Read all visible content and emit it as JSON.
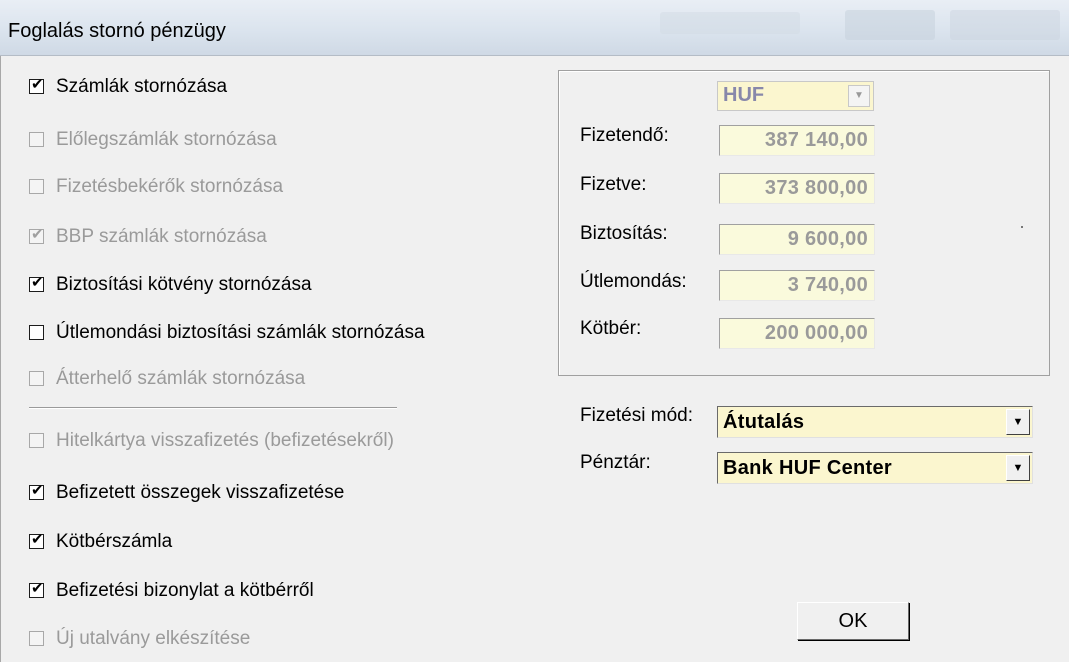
{
  "window": {
    "title": "Foglalás stornó pénzügy"
  },
  "checkboxes": [
    {
      "label": "Számlák stornózása",
      "checked": true,
      "enabled": true
    },
    {
      "label": "Előlegszámlák stornózása",
      "checked": false,
      "enabled": false
    },
    {
      "label": "Fizetésbekérők stornózása",
      "checked": false,
      "enabled": false
    },
    {
      "label": "BBP számlák stornózása",
      "checked": true,
      "enabled": false
    },
    {
      "label": "Biztosítási kötvény stornózása",
      "checked": true,
      "enabled": true
    },
    {
      "label": "Útlemondási biztosítási számlák stornózása",
      "checked": false,
      "enabled": true
    },
    {
      "label": "Átterhelő számlák stornózása",
      "checked": false,
      "enabled": false
    },
    {
      "label": "Hitelkártya visszafizetés (befizetésekről)",
      "checked": false,
      "enabled": false
    },
    {
      "label": "Befizetett összegek visszafizetése",
      "checked": true,
      "enabled": true
    },
    {
      "label": "Kötbérszámla",
      "checked": true,
      "enabled": true
    },
    {
      "label": "Befizetési bizonylat a kötbérről",
      "checked": true,
      "enabled": true
    },
    {
      "label": "Új utalvány elkészítése",
      "checked": false,
      "enabled": false
    }
  ],
  "currency": {
    "value": "HUF"
  },
  "amounts": [
    {
      "label": "Fizetendő:",
      "value": "387 140,00"
    },
    {
      "label": "Fizetve:",
      "value": "373 800,00"
    },
    {
      "label": "Biztosítás:",
      "value": "9 600,00"
    },
    {
      "label": "Útlemondás:",
      "value": "3 740,00"
    },
    {
      "label": "Kötbér:",
      "value": "200 000,00"
    }
  ],
  "payment": {
    "mode_label": "Fizetési mód:",
    "mode_value": "Átutalás",
    "cashdesk_label": "Pénztár:",
    "cashdesk_value": "Bank HUF Center"
  },
  "buttons": {
    "ok": "OK"
  },
  "icons": {
    "check": "check-mark-icon",
    "dropdown": "chevron-down-icon"
  }
}
